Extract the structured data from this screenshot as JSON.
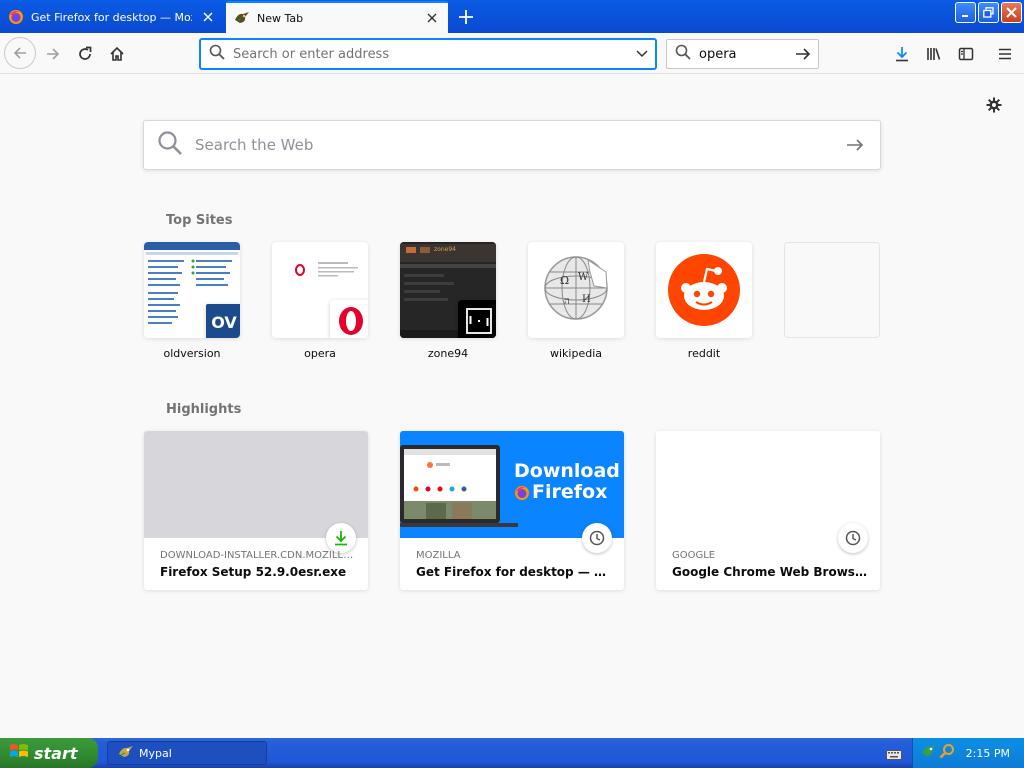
{
  "tabs": [
    {
      "title": "Get Firefox for desktop — Mozilla",
      "active": false,
      "icon": "firefox-icon"
    },
    {
      "title": "New Tab",
      "active": true,
      "icon": "mypal-icon"
    }
  ],
  "navbar": {
    "url_placeholder": "Search or enter address",
    "url_value": "",
    "search_value": "opera"
  },
  "newtab": {
    "search_placeholder": "Search the Web",
    "topsites_title": "Top Sites",
    "highlights_title": "Highlights",
    "top_sites": [
      {
        "label": "oldversion",
        "icon": "oldversion-thumbnail"
      },
      {
        "label": "opera",
        "icon": "opera-icon"
      },
      {
        "label": "zone94",
        "icon": "zone94-thumbnail"
      },
      {
        "label": "wikipedia",
        "icon": "wikipedia-icon"
      },
      {
        "label": "reddit",
        "icon": "reddit-icon"
      },
      {
        "label": "",
        "icon": "empty-slot"
      }
    ],
    "highlights": [
      {
        "host": "DOWNLOAD-INSTALLER.CDN.MOZILLA ...",
        "title": "Firefox Setup 52.9.0esr.exe",
        "type": "download-icon"
      },
      {
        "host": "MOZILLA",
        "title": "Get Firefox for desktop — Mozil...",
        "type": "history-clock-icon",
        "banner": {
          "line1": "Download",
          "line2": "Firefox"
        }
      },
      {
        "host": "GOOGLE",
        "title": "Google Chrome Web Browser",
        "type": "history-clock-icon"
      }
    ],
    "zone94_label": "zone94"
  },
  "taskbar": {
    "start_label": "start",
    "task_label": "Mypal",
    "clock": "2:15 PM"
  },
  "colors": {
    "accent": "#0a84ff",
    "reddit": "#ff4500",
    "opera": "#e3002c",
    "firefox_banner": "#0a84ff",
    "xp_taskbar": "#245edb",
    "xp_start": "#3c9b3c"
  }
}
